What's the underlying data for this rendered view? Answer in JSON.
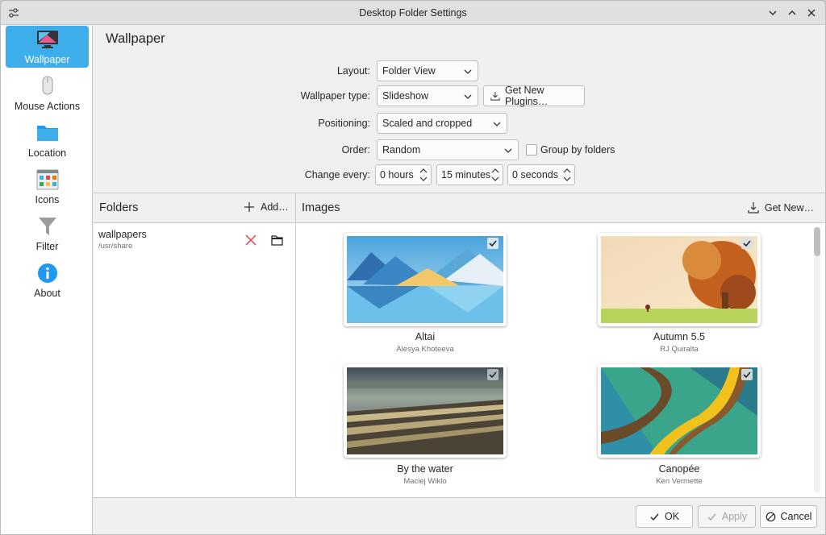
{
  "window": {
    "title": "Desktop Folder Settings"
  },
  "sidebar": {
    "items": [
      {
        "label": "Wallpaper",
        "icon": "monitor-icon",
        "active": true
      },
      {
        "label": "Mouse Actions",
        "icon": "mouse-icon"
      },
      {
        "label": "Location",
        "icon": "folder-icon"
      },
      {
        "label": "Icons",
        "icon": "icons-grid-icon"
      },
      {
        "label": "Filter",
        "icon": "filter-icon"
      },
      {
        "label": "About",
        "icon": "info-icon"
      }
    ]
  },
  "page": {
    "title": "Wallpaper"
  },
  "form": {
    "layout_label": "Layout:",
    "layout_value": "Folder View",
    "type_label": "Wallpaper type:",
    "type_value": "Slideshow",
    "get_plugins_label": "Get New Plugins…",
    "positioning_label": "Positioning:",
    "positioning_value": "Scaled and cropped",
    "order_label": "Order:",
    "order_value": "Random",
    "group_label": "Group by folders",
    "group_checked": false,
    "change_label": "Change every:",
    "hours_value": "0 hours",
    "minutes_value": "15 minutes",
    "seconds_value": "0 seconds"
  },
  "folders": {
    "header": "Folders",
    "add_label": "Add…",
    "items": [
      {
        "name": "wallpapers",
        "path": "/usr/share"
      }
    ]
  },
  "images": {
    "header": "Images",
    "get_new_label": "Get New…",
    "items": [
      {
        "name": "Altai",
        "author": "Alesya Khoteeva",
        "checked": true
      },
      {
        "name": "Autumn 5.5",
        "author": "RJ Quiralta",
        "checked": true
      },
      {
        "name": "By the water",
        "author": "Maciej Wiklo",
        "checked": true
      },
      {
        "name": "Canopée",
        "author": "Ken Vermette",
        "checked": true
      }
    ]
  },
  "footer": {
    "ok_label": "OK",
    "apply_label": "Apply",
    "cancel_label": "Cancel"
  },
  "colors": {
    "accent": "#3daee9",
    "danger": "#da4453"
  }
}
